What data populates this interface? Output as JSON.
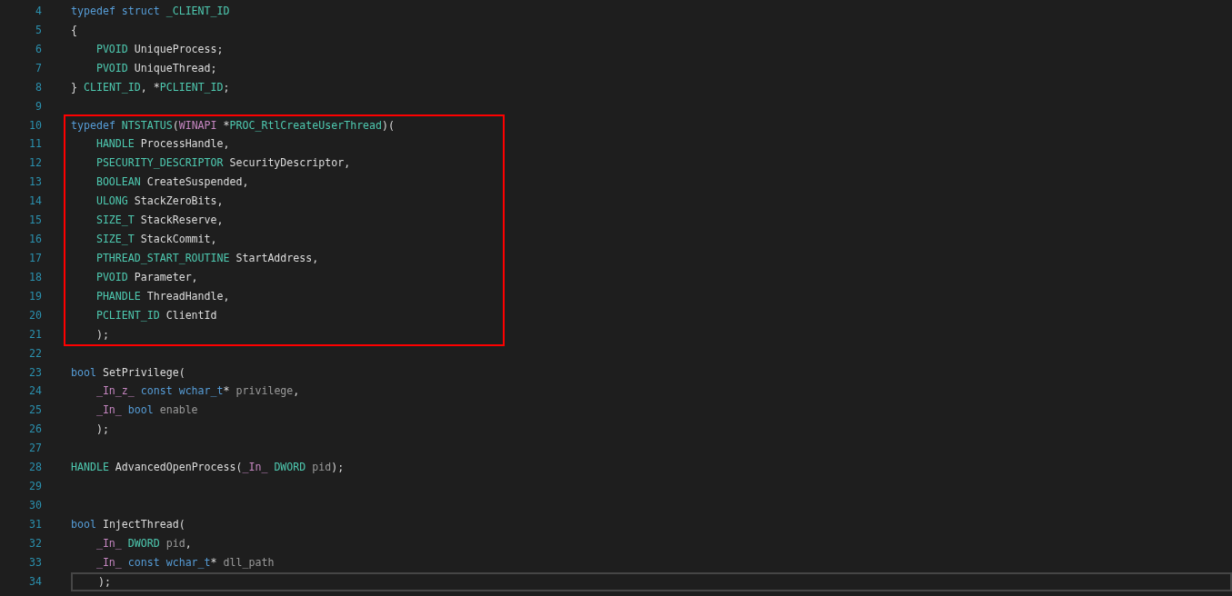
{
  "sections": [
    {
      "boxed": false,
      "lines": [
        {
          "number": "4",
          "current": false,
          "indented": false,
          "tokens": [
            {
              "text": "typedef struct ",
              "kind": "kw"
            },
            {
              "text": "_CLIENT_ID",
              "kind": "type"
            }
          ]
        },
        {
          "number": "5",
          "current": false,
          "indented": false,
          "tokens": [
            {
              "text": "{",
              "kind": "plain"
            }
          ]
        },
        {
          "number": "6",
          "current": false,
          "indented": true,
          "tokens": [
            {
              "text": "PVOID",
              "kind": "type"
            },
            {
              "text": " UniqueProcess;",
              "kind": "plain"
            }
          ]
        },
        {
          "number": "7",
          "current": false,
          "indented": true,
          "tokens": [
            {
              "text": "PVOID",
              "kind": "type"
            },
            {
              "text": " UniqueThread;",
              "kind": "plain"
            }
          ]
        },
        {
          "number": "8",
          "current": false,
          "indented": false,
          "tokens": [
            {
              "text": "} ",
              "kind": "plain"
            },
            {
              "text": "CLIENT_ID",
              "kind": "type"
            },
            {
              "text": ", *",
              "kind": "plain"
            },
            {
              "text": "PCLIENT_ID",
              "kind": "type"
            },
            {
              "text": ";",
              "kind": "plain"
            }
          ]
        },
        {
          "number": "9",
          "current": false
        }
      ]
    },
    {
      "boxed": true,
      "lines": [
        {
          "number": "10",
          "current": false,
          "indented": false,
          "tokens": [
            {
              "text": "typedef ",
              "kind": "kw"
            },
            {
              "text": "NTSTATUS",
              "kind": "type"
            },
            {
              "text": "(",
              "kind": "plain"
            },
            {
              "text": "WINAPI",
              "kind": "macro"
            },
            {
              "text": " *",
              "kind": "plain"
            },
            {
              "text": "PROC_RtlCreateUserThread",
              "kind": "type"
            },
            {
              "text": ")(",
              "kind": "plain"
            }
          ]
        },
        {
          "number": "11",
          "current": false,
          "indented": true,
          "tokens": [
            {
              "text": "HANDLE",
              "kind": "type"
            },
            {
              "text": " ProcessHandle,",
              "kind": "plain"
            }
          ]
        },
        {
          "number": "12",
          "current": false,
          "indented": true,
          "tokens": [
            {
              "text": "PSECURITY_DESCRIPTOR",
              "kind": "type"
            },
            {
              "text": " SecurityDescriptor,",
              "kind": "plain"
            }
          ]
        },
        {
          "number": "13",
          "current": false,
          "indented": true,
          "tokens": [
            {
              "text": "BOOLEAN",
              "kind": "type"
            },
            {
              "text": " CreateSuspended,",
              "kind": "plain"
            }
          ]
        },
        {
          "number": "14",
          "current": false,
          "indented": true,
          "tokens": [
            {
              "text": "ULONG",
              "kind": "type"
            },
            {
              "text": " StackZeroBits,",
              "kind": "plain"
            }
          ]
        },
        {
          "number": "15",
          "current": false,
          "indented": true,
          "tokens": [
            {
              "text": "SIZE_T",
              "kind": "type"
            },
            {
              "text": " StackReserve,",
              "kind": "plain"
            }
          ]
        },
        {
          "number": "16",
          "current": false,
          "indented": true,
          "tokens": [
            {
              "text": "SIZE_T",
              "kind": "type"
            },
            {
              "text": " StackCommit,",
              "kind": "plain"
            }
          ]
        },
        {
          "number": "17",
          "current": false,
          "indented": true,
          "tokens": [
            {
              "text": "PTHREAD_START_ROUTINE",
              "kind": "type"
            },
            {
              "text": " StartAddress,",
              "kind": "plain"
            }
          ]
        },
        {
          "number": "18",
          "current": false,
          "indented": true,
          "tokens": [
            {
              "text": "PVOID",
              "kind": "type"
            },
            {
              "text": " Parameter,",
              "kind": "plain"
            }
          ]
        },
        {
          "number": "19",
          "current": false,
          "indented": true,
          "tokens": [
            {
              "text": "PHANDLE",
              "kind": "type"
            },
            {
              "text": " ThreadHandle,",
              "kind": "plain"
            }
          ]
        },
        {
          "number": "20",
          "current": false,
          "indented": true,
          "tokens": [
            {
              "text": "PCLIENT_ID",
              "kind": "type"
            },
            {
              "text": " ClientId",
              "kind": "plain"
            }
          ]
        },
        {
          "number": "21",
          "current": false,
          "indented": true,
          "tokens": [
            {
              "text": ");",
              "kind": "plain"
            }
          ]
        }
      ]
    },
    {
      "boxed": false,
      "lines": [
        {
          "number": "22",
          "current": false
        },
        {
          "number": "23",
          "current": false,
          "indented": false,
          "tokens": [
            {
              "text": "bool",
              "kind": "kw"
            },
            {
              "text": " SetPrivilege(",
              "kind": "plain"
            }
          ]
        },
        {
          "number": "24",
          "current": false,
          "indented": true,
          "tokens": [
            {
              "text": "_In_z_",
              "kind": "macro"
            },
            {
              "text": " const wchar_t",
              "kind": "kw"
            },
            {
              "text": "* ",
              "kind": "plain"
            },
            {
              "text": "privilege",
              "kind": "param"
            },
            {
              "text": ",",
              "kind": "plain"
            }
          ]
        },
        {
          "number": "25",
          "current": false,
          "indented": true,
          "tokens": [
            {
              "text": "_In_",
              "kind": "macro"
            },
            {
              "text": " bool",
              "kind": "kw"
            },
            {
              "text": " enable",
              "kind": "param"
            }
          ]
        },
        {
          "number": "26",
          "current": false,
          "indented": true,
          "tokens": [
            {
              "text": ");",
              "kind": "plain"
            }
          ]
        },
        {
          "number": "27",
          "current": false
        },
        {
          "number": "28",
          "current": false,
          "indented": false,
          "tokens": [
            {
              "text": "HANDLE",
              "kind": "type"
            },
            {
              "text": " AdvancedOpenProcess(",
              "kind": "plain"
            },
            {
              "text": "_In_",
              "kind": "macro"
            },
            {
              "text": " DWORD",
              "kind": "type"
            },
            {
              "text": " pid",
              "kind": "param"
            },
            {
              "text": ");",
              "kind": "plain"
            }
          ]
        },
        {
          "number": "29",
          "current": false
        },
        {
          "number": "30",
          "current": false
        },
        {
          "number": "31",
          "current": false,
          "indented": false,
          "tokens": [
            {
              "text": "bool",
              "kind": "kw"
            },
            {
              "text": " InjectThread(",
              "kind": "plain"
            }
          ]
        },
        {
          "number": "32",
          "current": false,
          "indented": true,
          "tokens": [
            {
              "text": "_In_",
              "kind": "macro"
            },
            {
              "text": " DWORD",
              "kind": "type"
            },
            {
              "text": " pid",
              "kind": "param"
            },
            {
              "text": ",",
              "kind": "plain"
            }
          ]
        },
        {
          "number": "33",
          "current": false,
          "indented": true,
          "tokens": [
            {
              "text": "_In_",
              "kind": "macro"
            },
            {
              "text": " const wchar_t",
              "kind": "kw"
            },
            {
              "text": "* ",
              "kind": "plain"
            },
            {
              "text": "dll_path",
              "kind": "param"
            }
          ]
        },
        {
          "number": "34",
          "current": true,
          "indented": true,
          "tokens": [
            {
              "text": ");",
              "kind": "plain"
            }
          ]
        }
      ]
    }
  ]
}
